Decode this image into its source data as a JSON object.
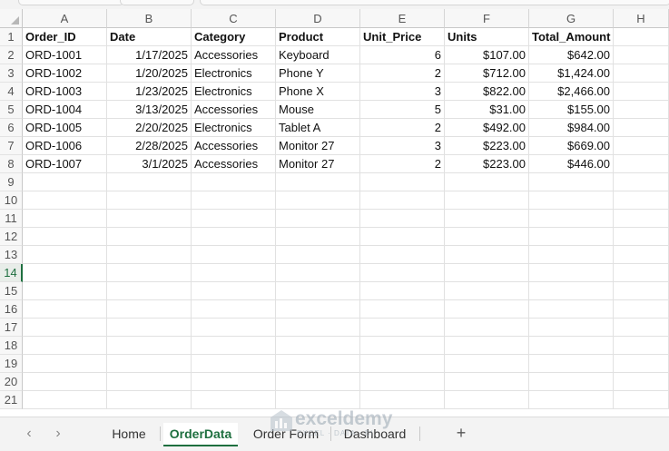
{
  "columns": [
    "A",
    "B",
    "C",
    "D",
    "E",
    "F",
    "G",
    "H"
  ],
  "row_numbers": [
    "1",
    "2",
    "3",
    "4",
    "5",
    "6",
    "7",
    "8",
    "9",
    "10",
    "11",
    "12",
    "13",
    "14",
    "15",
    "16",
    "17",
    "18",
    "19",
    "20",
    "21"
  ],
  "active_row": "14",
  "table": {
    "headers": [
      "Order_ID",
      "Date",
      "Category",
      "Product",
      "Unit_Price",
      "Units",
      "Total_Amount"
    ],
    "rows": [
      [
        "ORD-1001",
        "1/17/2025",
        "Accessories",
        "Keyboard",
        "6",
        "$107.00",
        "$642.00"
      ],
      [
        "ORD-1002",
        "1/20/2025",
        "Electronics",
        "Phone Y",
        "2",
        "$712.00",
        "$1,424.00"
      ],
      [
        "ORD-1003",
        "1/23/2025",
        "Electronics",
        "Phone X",
        "3",
        "$822.00",
        "$2,466.00"
      ],
      [
        "ORD-1004",
        "3/13/2025",
        "Accessories",
        "Mouse",
        "5",
        "$31.00",
        "$155.00"
      ],
      [
        "ORD-1005",
        "2/20/2025",
        "Electronics",
        "Tablet A",
        "2",
        "$492.00",
        "$984.00"
      ],
      [
        "ORD-1006",
        "2/28/2025",
        "Accessories",
        "Monitor 27",
        "3",
        "$223.00",
        "$669.00"
      ],
      [
        "ORD-1007",
        "3/1/2025",
        "Accessories",
        "Monitor 27",
        "2",
        "$223.00",
        "$446.00"
      ]
    ]
  },
  "sheet_tabs": [
    {
      "label": "Home",
      "active": false
    },
    {
      "label": "OrderData",
      "active": true
    },
    {
      "label": "Order Form",
      "active": false
    },
    {
      "label": "Dashboard",
      "active": false
    }
  ],
  "nav": {
    "prev_icon": "chevron-left-icon",
    "next_icon": "chevron-right-icon",
    "add_label": "+"
  },
  "watermark": {
    "text": "exceldemy",
    "subtext": "EXCEL · DATA · BI"
  },
  "colors": {
    "accent": "#1e6f3f",
    "grid_line": "#e1e1e1",
    "header_bg": "#f7f7f7"
  }
}
